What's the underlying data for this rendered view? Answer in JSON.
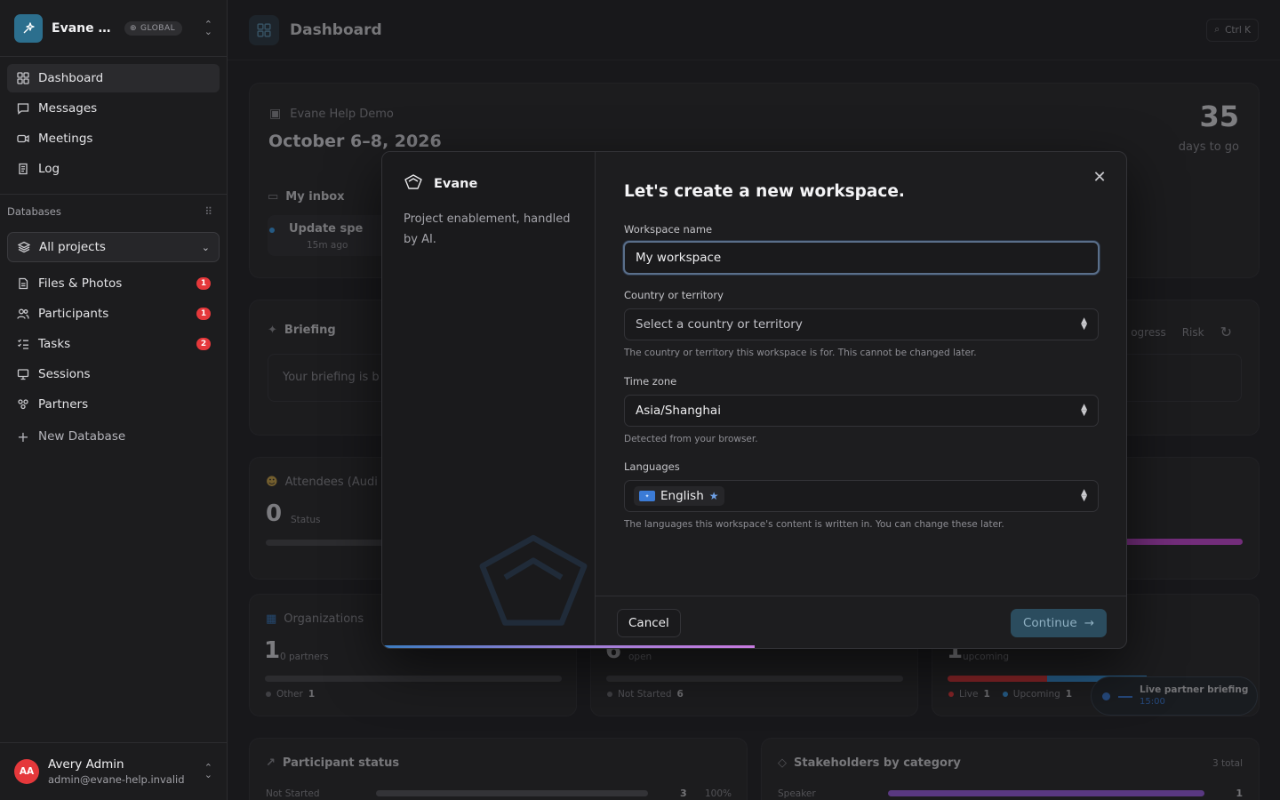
{
  "workspace": {
    "name": "Evane Help Demo",
    "short_name": "Evane He...",
    "badge": "GLOBAL"
  },
  "nav": [
    {
      "label": "Dashboard",
      "icon": "dashboard-icon",
      "active": true
    },
    {
      "label": "Messages",
      "icon": "message-icon"
    },
    {
      "label": "Meetings",
      "icon": "video-icon"
    },
    {
      "label": "Log",
      "icon": "log-icon"
    }
  ],
  "databases": {
    "label": "Databases",
    "selector": "All projects",
    "items": [
      {
        "label": "Files & Photos",
        "badge": "1"
      },
      {
        "label": "Participants",
        "badge": "1"
      },
      {
        "label": "Tasks",
        "badge": "2"
      },
      {
        "label": "Sessions",
        "badge": ""
      },
      {
        "label": "Partners",
        "badge": ""
      }
    ],
    "new_label": "New Database"
  },
  "user": {
    "initials": "AA",
    "name": "Avery Admin",
    "email": "admin@evane-help.invalid"
  },
  "dashboard": {
    "title": "Dashboard",
    "search_kbd": "Ctrl K",
    "event_name": "Evane Help Demo",
    "event_dates": "October 6–8, 2026",
    "countdown_value": "35",
    "countdown_label": "days to go",
    "inbox_title": "My inbox",
    "inbox_item": "Update spe",
    "inbox_time": "15m ago",
    "briefing_title": "Briefing",
    "briefing_text": "Your briefing is b",
    "briefing_tabs": [
      "ogress",
      "Risk"
    ],
    "attendees_title": "Attendees (Audi",
    "attendees_value": "0",
    "attendees_sub": "Status",
    "orgs_title": "Organizations",
    "orgs_value": "1",
    "orgs_sub": "0 partners",
    "orgs_legend": "Other",
    "orgs_legend_count": "1",
    "tasks_value": "6",
    "tasks_sub": "open",
    "tasks_legend": "Not Started",
    "tasks_legend_count": "6",
    "sessions_value": "1",
    "sessions_sub": "upcoming",
    "sessions_legend": [
      {
        "label": "Live",
        "count": "1",
        "color": "#e5383b"
      },
      {
        "label": "Upcoming",
        "count": "1",
        "color": "#3b9be5"
      }
    ],
    "live_title": "Live partner briefing",
    "live_time": "15:00",
    "pstatus_title": "Participant status",
    "pstatus_row": "Not Started",
    "pstatus_count": "3",
    "pstatus_pct": "100%",
    "stake_title": "Stakeholders by category",
    "stake_total": "3 total",
    "stake_row": "Speaker",
    "stake_count": "1"
  },
  "modal": {
    "brand": "Evane",
    "tagline": "Project enablement, handled by AI.",
    "heading": "Let's create a new workspace.",
    "name_label": "Workspace name",
    "name_value": "My workspace",
    "country_label": "Country or territory",
    "country_placeholder": "Select a country or territory",
    "country_help": "The country or territory this workspace is for. This cannot be changed later.",
    "tz_label": "Time zone",
    "tz_value": "Asia/Shanghai",
    "tz_help": "Detected from your browser.",
    "lang_label": "Languages",
    "lang_value": "English",
    "lang_help": "The languages this workspace's content is written in. You can change these later.",
    "cancel": "Cancel",
    "continue": "Continue",
    "progress": 0.5
  },
  "colors": {
    "accent": "#2c6f8e",
    "danger": "#e5383b",
    "continue_bg": "#2b4c5e"
  }
}
